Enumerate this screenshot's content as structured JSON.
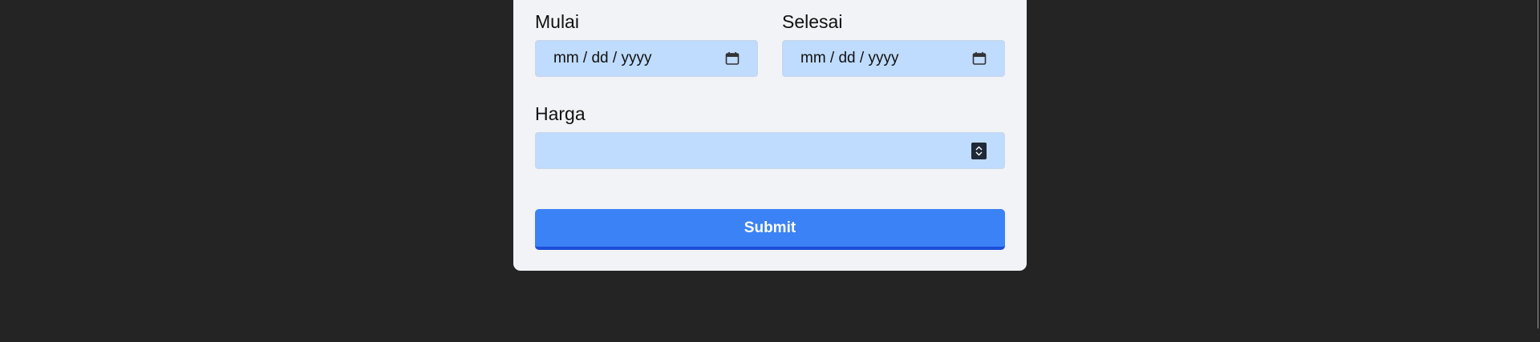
{
  "form": {
    "start": {
      "label": "Mulai",
      "placeholder": "mm / dd / yyyy"
    },
    "end": {
      "label": "Selesai",
      "placeholder": "mm / dd / yyyy"
    },
    "price": {
      "label": "Harga",
      "value": ""
    },
    "submit_label": "Submit"
  },
  "colors": {
    "background": "#242424",
    "card": "#f2f3f6",
    "input": "#bfdbfe",
    "button": "#3b82f6",
    "button_border": "#1d4ed8"
  },
  "icons": {
    "date": "calendar-icon",
    "number": "spinner-icon"
  }
}
